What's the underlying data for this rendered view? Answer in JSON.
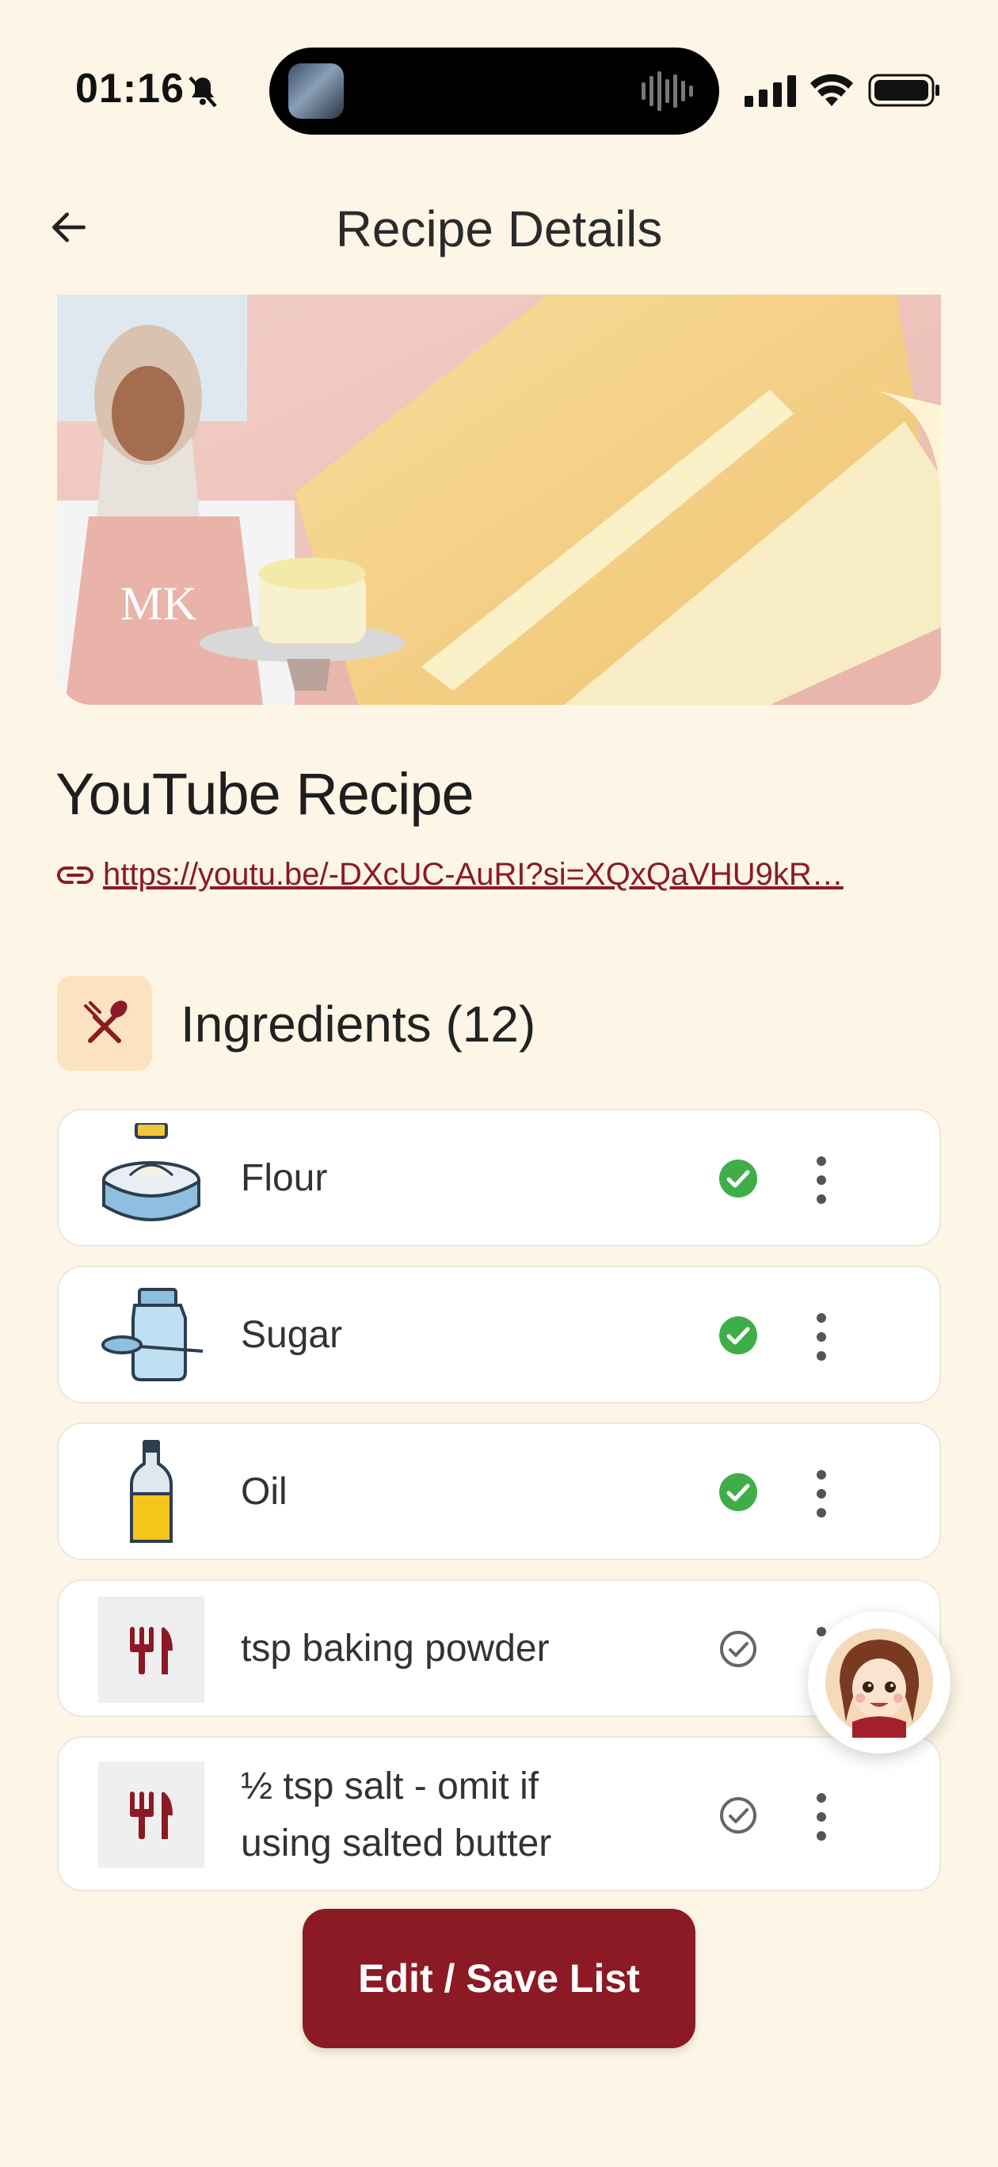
{
  "status_bar": {
    "time": "01:16"
  },
  "header": {
    "title": "Recipe Details"
  },
  "recipe": {
    "title": "YouTube Recipe",
    "link": "https://youtu.be/-DXcUC-AuRI?si=XQxQaVHU9kR…",
    "hero_logo_text": "MK"
  },
  "ingredients": {
    "title": "Ingredients (12)",
    "items": [
      {
        "label": "Flour",
        "checked": true,
        "icon": "flour-bowl-icon"
      },
      {
        "label": "Sugar",
        "checked": true,
        "icon": "sugar-jar-icon"
      },
      {
        "label": "Oil",
        "checked": true,
        "icon": "oil-bottle-icon"
      },
      {
        "label": "tsp baking powder",
        "checked": false,
        "icon": "utensils-icon"
      },
      {
        "label": "½ tsp salt - omit if",
        "label2": "using salted butter",
        "checked": false,
        "icon": "utensils-icon"
      }
    ]
  },
  "actions": {
    "save_label": "Edit / Save List"
  },
  "colors": {
    "accent": "#8b1a24",
    "background": "#fdf6e6",
    "check_green": "#3fae49"
  }
}
